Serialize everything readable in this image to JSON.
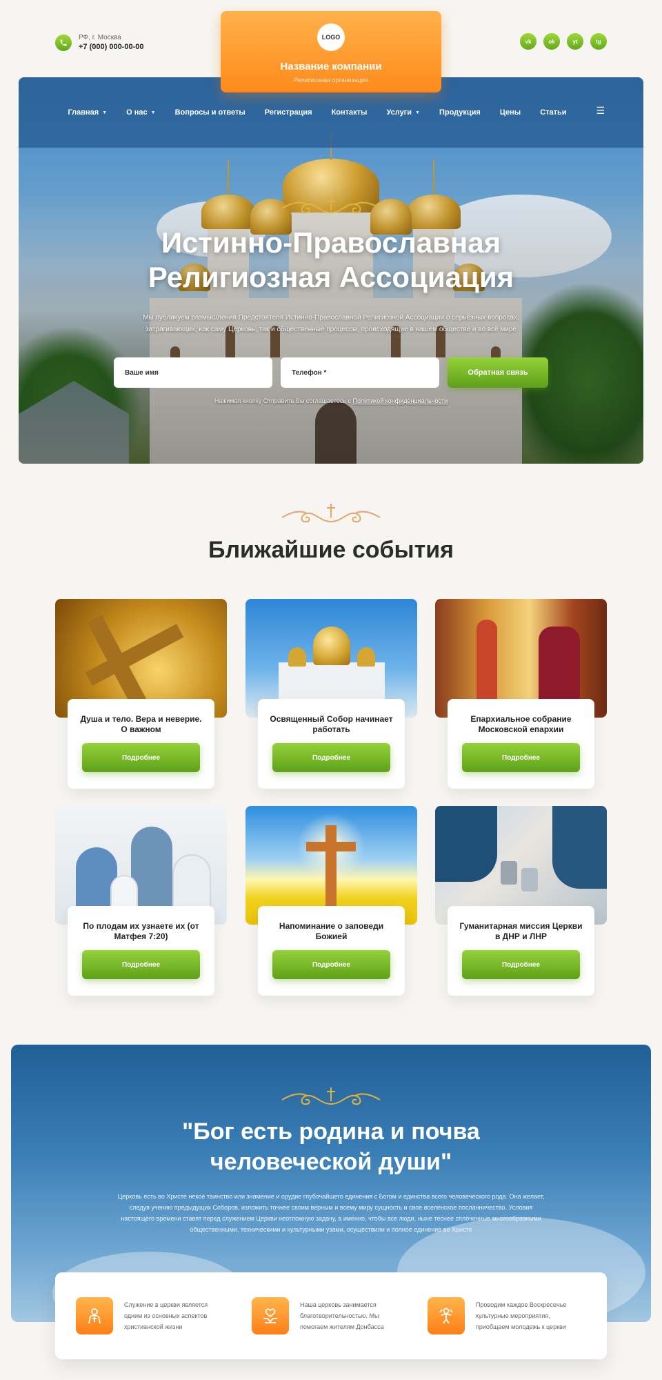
{
  "header": {
    "city": "РФ, г. Москва",
    "phone": "+7 (000) 000-00-00",
    "logo_text": "LOGO",
    "company_name": "Название компании",
    "company_subtitle": "Религиозная организация",
    "socials": [
      {
        "label": "vk",
        "icon": "vk-icon"
      },
      {
        "label": "ok",
        "icon": "odnoklassniki-icon"
      },
      {
        "label": "yt",
        "icon": "youtube-icon"
      },
      {
        "label": "tg",
        "icon": "telegram-icon"
      }
    ]
  },
  "nav": {
    "items": [
      {
        "label": "Главная",
        "dropdown": true
      },
      {
        "label": "О нас",
        "dropdown": true
      },
      {
        "label": "Вопросы и ответы",
        "dropdown": false
      },
      {
        "label": "Регистрация",
        "dropdown": false
      },
      {
        "label": "Контакты",
        "dropdown": false
      },
      {
        "label": "Услуги",
        "dropdown": true
      },
      {
        "label": "Продукция",
        "dropdown": false
      },
      {
        "label": "Цены",
        "dropdown": false
      },
      {
        "label": "Статьи",
        "dropdown": false
      }
    ],
    "menu_icon": "☰"
  },
  "hero": {
    "title_line1": "Истинно-Православная",
    "title_line2": "Религиозная Ассоциация",
    "description": "Мы публикуем размышления Предстоятеля Истинно-Православной Религиозной Ассоциации о серьёзных вопросах, затрагивающих, как саму Церковь, так и общественные процессы, происходящие в нашем обществе и во всё мире",
    "name_placeholder": "Ваше имя",
    "phone_placeholder": "Телефон *",
    "submit_label": "Обратная связь",
    "consent_text": "Нажимая кнопку Отправить Вы соглашаетесь с ",
    "consent_link": "Политикой конфиденциальности"
  },
  "events": {
    "title": "Ближайшие события",
    "button_label": "Подробнее",
    "items": [
      {
        "title": "Душа и тело. Вера и неверие. О важном"
      },
      {
        "title": "Освященный Собор начинает работать"
      },
      {
        "title": "Епархиальное собрание Московской епархии"
      },
      {
        "title": "По плодам их узнаете их (от Матфея 7:20)"
      },
      {
        "title": "Напоминание о заповеди Божией"
      },
      {
        "title": "Гуманитарная миссия Церкви в ДНР и ЛНР"
      }
    ]
  },
  "quote": {
    "title_line1": "\"Бог есть родина и почва",
    "title_line2": "человеческой души\"",
    "text": "Церковь есть во Христе некое таинство или знамение и орудие глубочайшего единения с Богом и единства всего человеческого рода. Она желает, следуя учению предыдущих Соборов, изложить точнее своим верным и всему миру сущность и свое вселенское посланничество. Условия настоящего времени ставят перед служением Церкви неотложную задачу, а именно, чтобы все люди, ныне теснее сплоченные многообразными общественными, техническими и культурными узами, осуществили и полное единение во Христе"
  },
  "features": [
    {
      "text": "Служение в церкви является одним из основных аспектов христианской жизни",
      "icon": "priest-icon"
    },
    {
      "text": "Наша церковь занимается благотворительностью. Мы помогаем жителям Донбасса",
      "icon": "helping-hands-icon"
    },
    {
      "text": "Проводим каждое Воскресенье культурные мероприятия, приобщаем молодежь к церкви",
      "icon": "youth-icon"
    }
  ],
  "colors": {
    "accent_green": "#6fb521",
    "accent_orange": "#ff8a1c",
    "nav_blue": "#285f96"
  }
}
